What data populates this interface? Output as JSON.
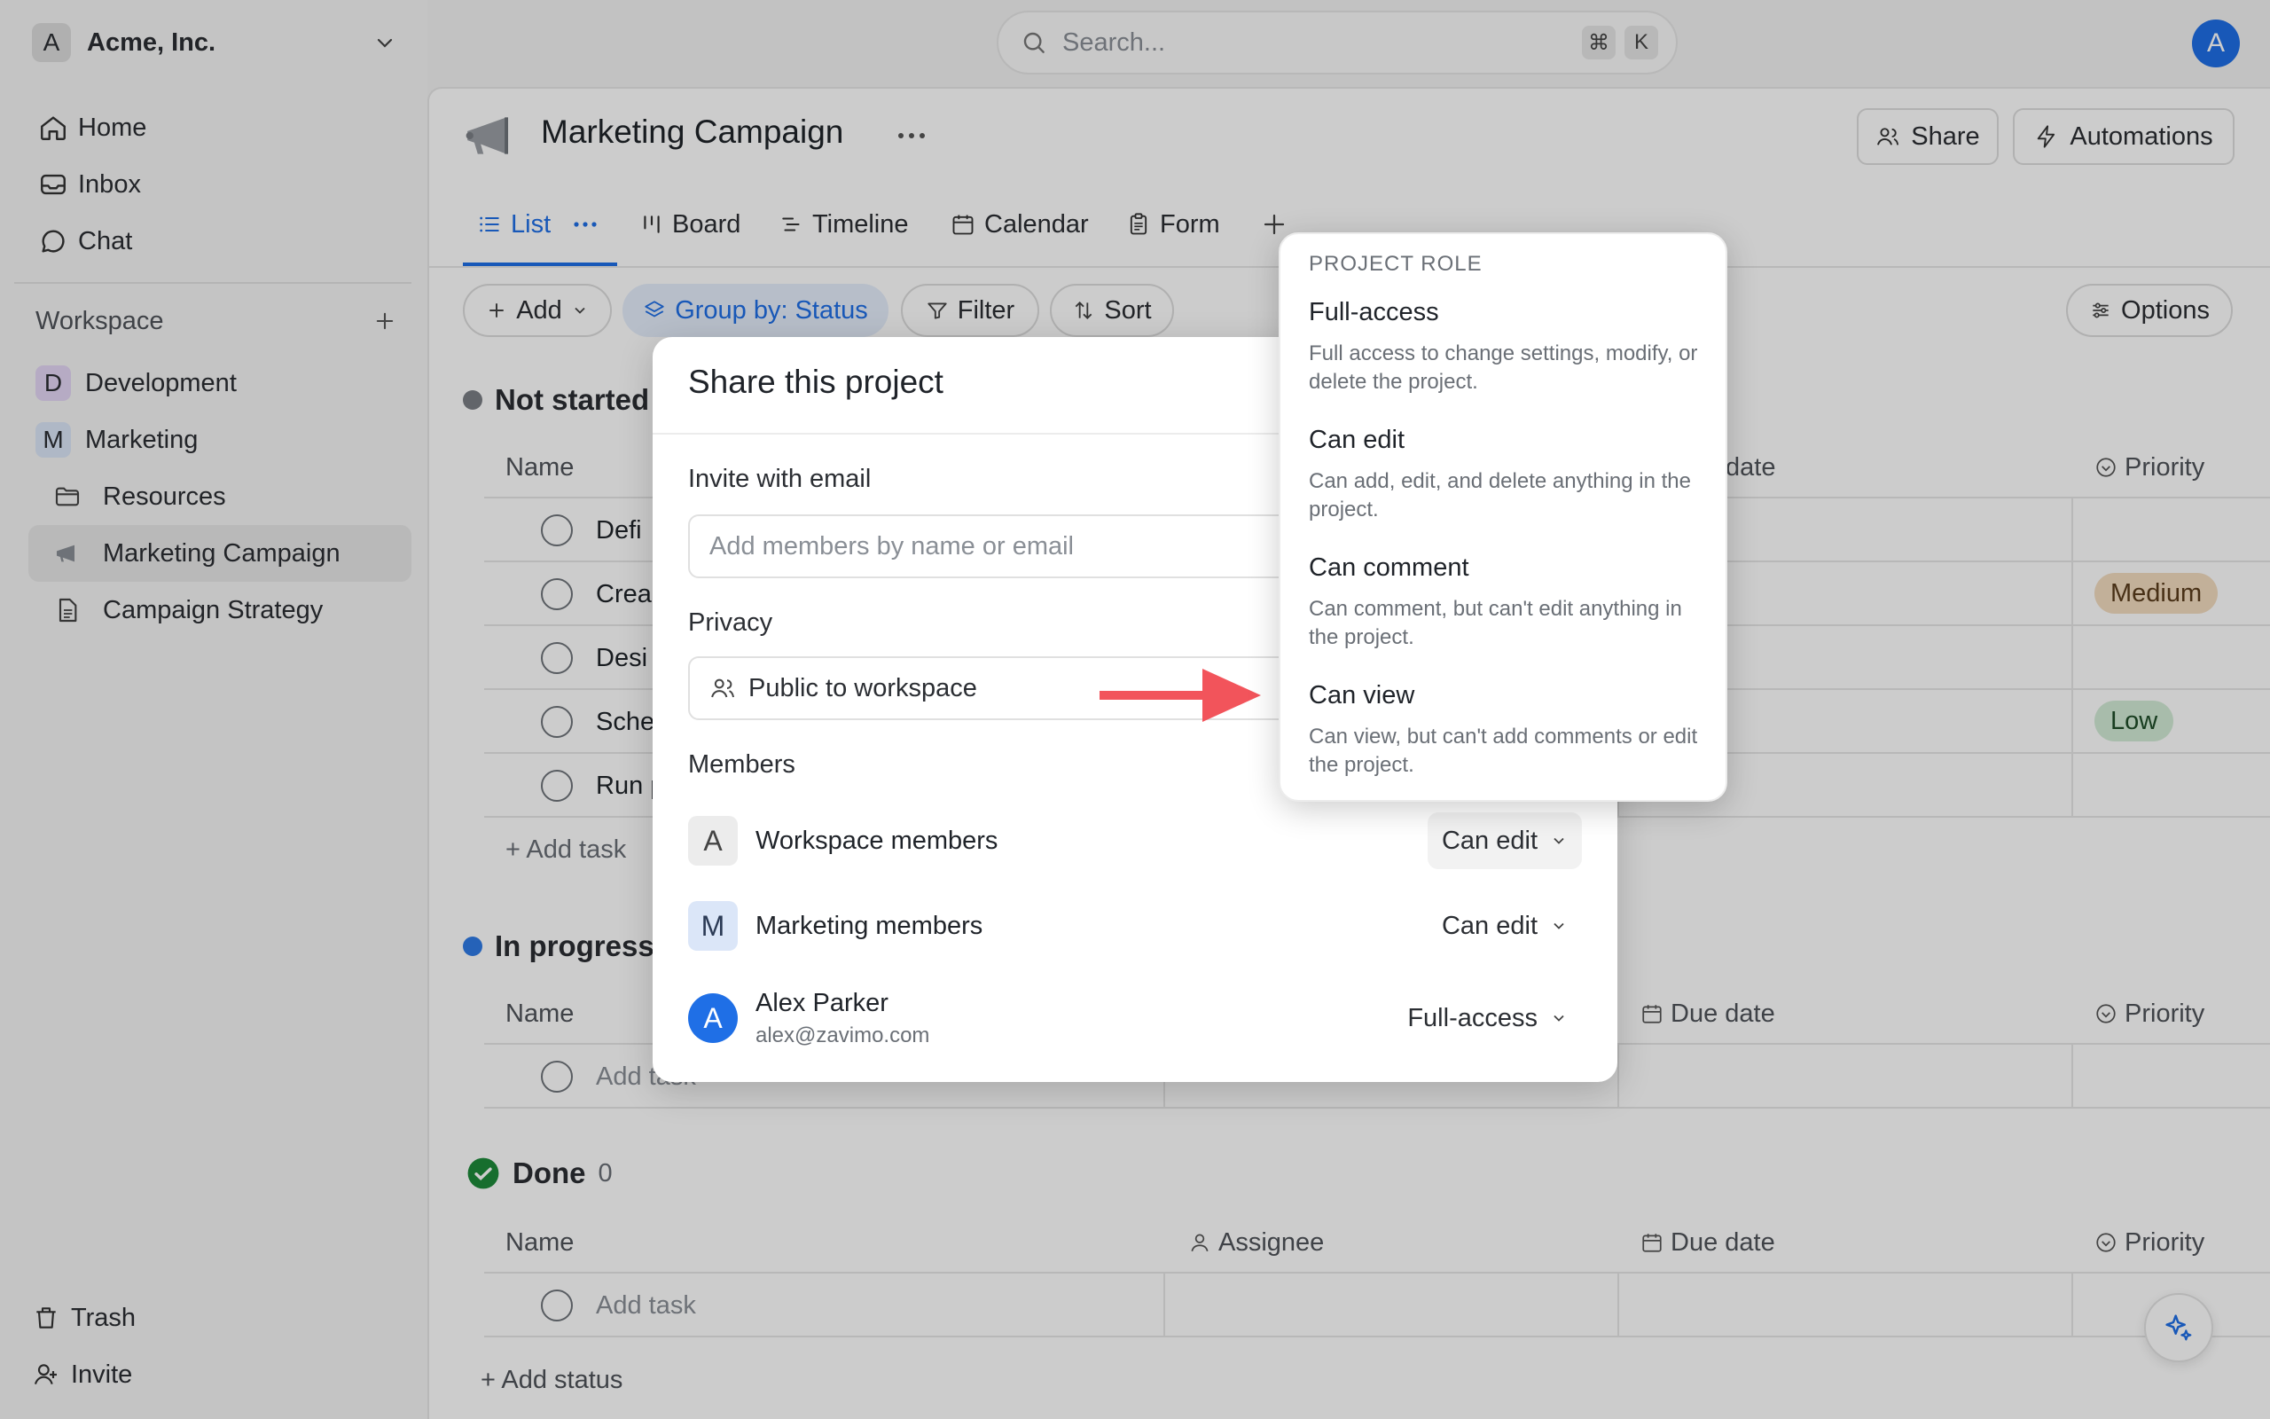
{
  "org": {
    "initial": "A",
    "name": "Acme, Inc."
  },
  "nav": [
    {
      "label": "Home",
      "icon": "home-icon"
    },
    {
      "label": "Inbox",
      "icon": "inbox-icon"
    },
    {
      "label": "Chat",
      "icon": "chat-icon"
    }
  ],
  "workspace": {
    "label": "Workspace",
    "items": [
      {
        "initial": "D",
        "label": "Development",
        "color": "#e4d6f5"
      },
      {
        "initial": "M",
        "label": "Marketing",
        "color": "#dbe6f8"
      }
    ],
    "children": [
      {
        "label": "Resources",
        "icon": "folder-icon"
      },
      {
        "label": "Marketing Campaign",
        "icon": "megaphone-icon"
      },
      {
        "label": "Campaign Strategy",
        "icon": "document-icon"
      }
    ]
  },
  "footer": {
    "trash": "Trash",
    "invite": "Invite"
  },
  "search": {
    "placeholder": "Search...",
    "shortcut_cmd": "⌘",
    "shortcut_key": "K"
  },
  "user": {
    "initial": "A"
  },
  "project": {
    "title": "Marketing Campaign",
    "share": "Share",
    "automations": "Automations"
  },
  "tabs": [
    "List",
    "Board",
    "Timeline",
    "Calendar",
    "Form"
  ],
  "toolbar": {
    "add": "Add",
    "group_by": "Group by: Status",
    "filter": "Filter",
    "sort": "Sort",
    "options": "Options"
  },
  "sections": {
    "not_started": {
      "title": "Not started",
      "color": "#7b7f85"
    },
    "in_progress": {
      "title": "In progress",
      "color": "#2f7be6"
    },
    "done": {
      "title": "Done",
      "count": "0",
      "color": "#1d8a3a"
    }
  },
  "columns": {
    "name": "Name",
    "assignee": "Assignee",
    "due_date": "Due date",
    "due_date_partial": "date",
    "priority": "Priority"
  },
  "tasks": [
    {
      "name": "Defi",
      "priority": ""
    },
    {
      "name": "Crea",
      "priority": "Medium"
    },
    {
      "name": "Desi",
      "priority": ""
    },
    {
      "name": "Sche",
      "priority": "Low"
    },
    {
      "name": "Run p",
      "priority": ""
    }
  ],
  "priority_colors": {
    "Medium": "#f3dcc0",
    "Low": "#d3ecd6"
  },
  "add_task": "+ Add task",
  "add_task_placeholder": "Add task",
  "add_status": "+ Add status",
  "modal": {
    "title": "Share this project",
    "invite_label": "Invite with email",
    "invite_placeholder": "Add members by name or email",
    "privacy_label": "Privacy",
    "privacy_value": "Public to workspace",
    "members_label": "Members",
    "members": [
      {
        "initial": "A",
        "name": "Workspace members",
        "role": "Can edit",
        "badge": "#ececec",
        "badge_text": "#444"
      },
      {
        "initial": "M",
        "name": "Marketing members",
        "role": "Can edit",
        "badge": "#dbe6f8",
        "badge_text": "#2b3a55"
      },
      {
        "initial": "A",
        "name": "Alex Parker",
        "email": "alex@zavimo.com",
        "role": "Full-access",
        "badge": "#1f6fe6",
        "badge_text": "#ffffff"
      }
    ]
  },
  "dropdown": {
    "caption": "PROJECT ROLE",
    "options": [
      {
        "title": "Full-access",
        "desc": "Full access to change settings, modify, or delete the project."
      },
      {
        "title": "Can edit",
        "desc": "Can add, edit, and delete anything in the project."
      },
      {
        "title": "Can comment",
        "desc": "Can comment, but can't edit anything in the project."
      },
      {
        "title": "Can view",
        "desc": "Can view, but can't add comments or edit the project."
      }
    ]
  },
  "colors": {
    "accent": "#1f6fe6",
    "arrow": "#f2545b"
  }
}
